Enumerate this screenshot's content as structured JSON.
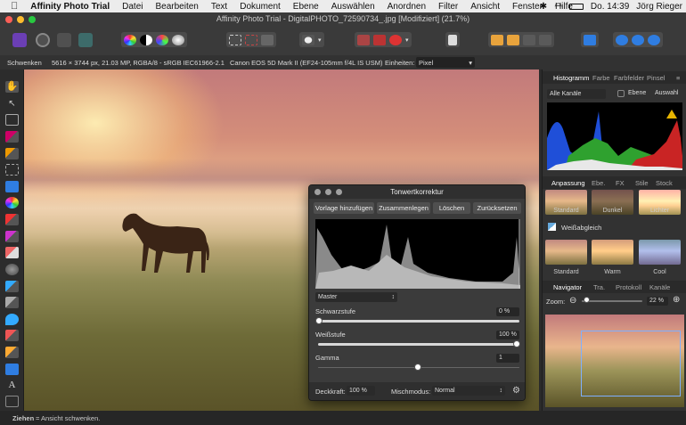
{
  "menubar": {
    "apple": "",
    "app_name": "Affinity Photo Trial",
    "items": [
      "Datei",
      "Bearbeiten",
      "Text",
      "Dokument",
      "Ebene",
      "Auswählen",
      "Anordnen",
      "Filter",
      "Ansicht",
      "Fenster",
      "Hilfe"
    ],
    "clock": "Do. 14:39",
    "user": "Jörg Rieger"
  },
  "window": {
    "title": "Affinity Photo Trial - DigitalPHOTO_72590734_.jpg [Modifiziert] (21.7%)"
  },
  "context": {
    "tool_name": "Schwenken",
    "image_info": "5616 × 3744 px, 21.03 MP, RGBA/8 - sRGB IEC61966-2.1",
    "camera": "Canon EOS 5D Mark II (EF24-105mm f/4L IS USM)",
    "units_label": "Einheiten:",
    "units_value": "Pixel"
  },
  "status": {
    "bold": "Ziehen",
    "text": " = Ansicht schwenken."
  },
  "panels": {
    "top_tabs": [
      "Histogramm",
      "Farbe",
      "Farbfelder",
      "Pinsel"
    ],
    "channel_select": "Alle Kanäle",
    "layer_checkbox": "Ebene",
    "selection_label": "Auswahl",
    "adjust_tabs": [
      "Anpassung",
      "Ebe.",
      "FX",
      "Stile",
      "Stock"
    ],
    "adjust_presets": [
      "Standard",
      "Dunkel",
      "Lichter"
    ],
    "wb_label": "Weißabgleich",
    "wb_presets": [
      "Standard",
      "Warm",
      "Cool"
    ],
    "nav_tabs": [
      "Navigator",
      "Tra.",
      "Protokoll",
      "Kanäle"
    ],
    "zoom_label": "Zoom:",
    "zoom_value": "22 %"
  },
  "dialog": {
    "title": "Tonwertkorrektur",
    "buttons": [
      "Vorlage hinzufügen",
      "Zusammenlegen",
      "Löschen",
      "Zurücksetzen"
    ],
    "channel": "Master",
    "black_label": "Schwarzstufe",
    "black_value": "0 %",
    "white_label": "Weißstufe",
    "white_value": "100 %",
    "gamma_label": "Gamma",
    "gamma_value": "1",
    "opacity_label": "Deckkraft:",
    "opacity_value": "100 %",
    "blend_label": "Mischmodus:",
    "blend_value": "Normal"
  },
  "colors": {
    "accent": "#2f7de1",
    "histogram_blue": "#1f4fd8",
    "histogram_green": "#2fa12f",
    "histogram_red": "#c92424",
    "warning": "#e6b400"
  }
}
